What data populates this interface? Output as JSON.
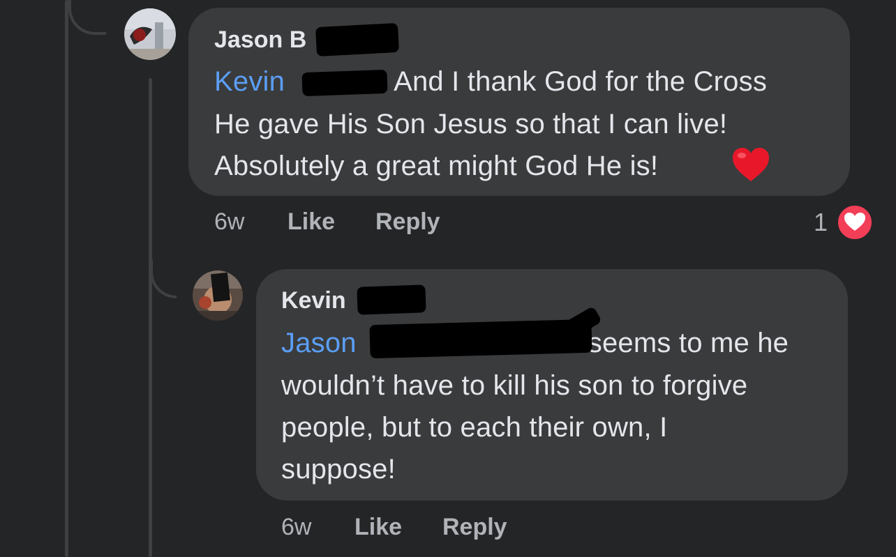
{
  "comments": [
    {
      "author": "Jason B",
      "lines": [
        {
          "mention": "Kevin",
          "text": "And I thank God for the Cross"
        },
        {
          "mention": "",
          "text": "He gave His Son Jesus so that I can live!"
        },
        {
          "mention": "",
          "text": "Absolutely a great might God He is!"
        }
      ],
      "emoji": "heart-emoji",
      "time": "6w",
      "like_label": "Like",
      "reply_label": "Reply",
      "reaction_count": "1",
      "reaction_icon": "heart-reaction-icon"
    },
    {
      "author": "Kevin",
      "lines": [
        {
          "mention": "Jason",
          "text": "seems to me he"
        },
        {
          "mention": "",
          "text": "wouldn’t have to kill his son to forgive"
        },
        {
          "mention": "",
          "text": "people, but to each their own, I"
        },
        {
          "mention": "",
          "text": "suppose!"
        }
      ],
      "time": "6w",
      "like_label": "Like",
      "reply_label": "Reply"
    }
  ],
  "colors": {
    "background": "#242526",
    "bubble": "#3a3b3c",
    "mention": "#5b9ef5",
    "reaction": "#f33e58"
  }
}
